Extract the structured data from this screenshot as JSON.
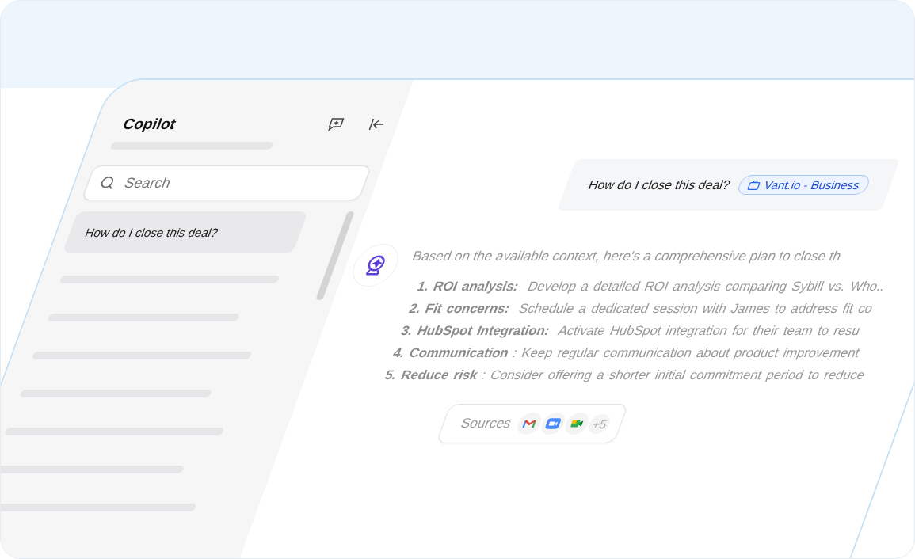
{
  "sidebar": {
    "title": "Copilot",
    "search": {
      "placeholder": "Search"
    },
    "conversations": [
      {
        "title": "How do I close this deal?",
        "selected": true
      }
    ]
  },
  "chat": {
    "question": {
      "text": "How do I close this deal?",
      "tag": "Vant.io - Business"
    },
    "answer": {
      "intro": "Based on the available context, here's a comprehensive plan to close th",
      "steps": [
        "**1. ROI analysis:** Develop a detailed ROI analysis comparing Sybill vs. Who..",
        "**2. Fit concerns:** Schedule a dedicated session with James to address fit co",
        "**3. HubSpot Integration:** Activate HubSpot integration for their team to resu",
        "**4. Communication**: Keep regular communication about product improvement",
        "**5. Reduce risk**: Consider offering a shorter initial commitment period to reduce"
      ]
    },
    "sources": {
      "label": "Sources",
      "more": "+5"
    }
  }
}
